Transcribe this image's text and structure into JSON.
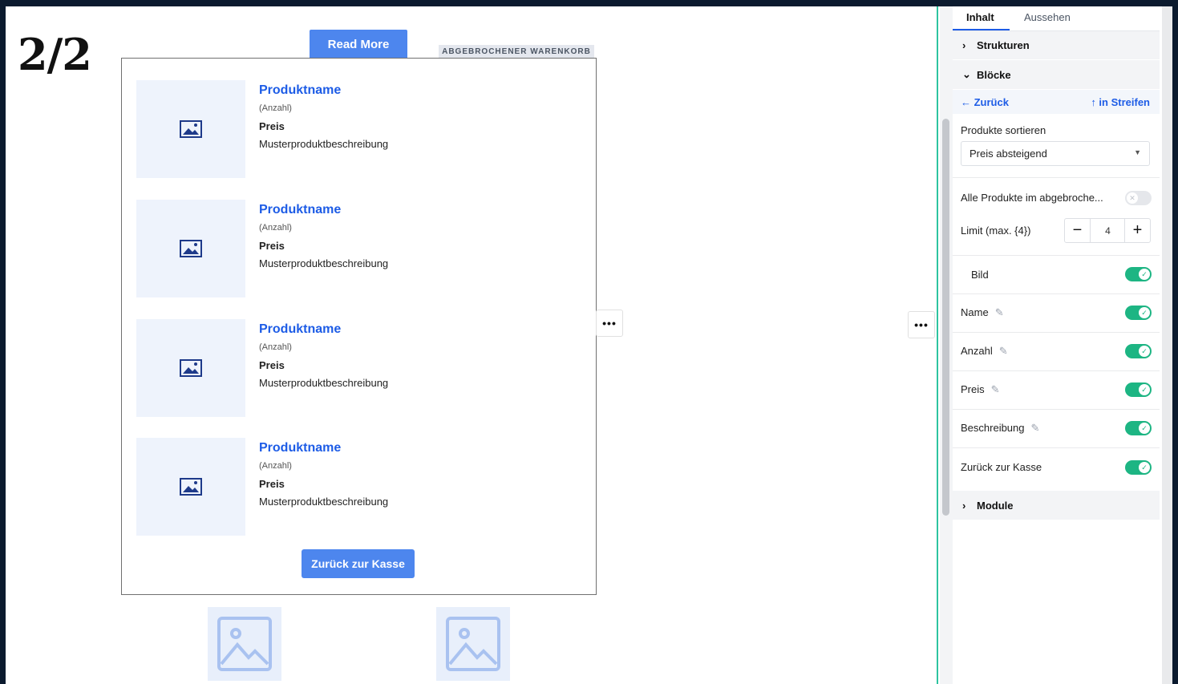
{
  "step": "2/2",
  "canvas": {
    "read_more_label": "Read More",
    "section_tag": "ABGEBROCHENER WARENKORB",
    "products": [
      {
        "name": "Produktname",
        "qty": "(Anzahl)",
        "price": "Preis",
        "desc": "Musterproduktbeschreibung"
      },
      {
        "name": "Produktname",
        "qty": "(Anzahl)",
        "price": "Preis",
        "desc": "Musterproduktbeschreibung"
      },
      {
        "name": "Produktname",
        "qty": "(Anzahl)",
        "price": "Preis",
        "desc": "Musterproduktbeschreibung"
      },
      {
        "name": "Produktname",
        "qty": "(Anzahl)",
        "price": "Preis",
        "desc": "Musterproduktbeschreibung"
      }
    ],
    "checkout_label": "Zurück zur Kasse",
    "more_icon": "•••"
  },
  "panel": {
    "tabs": [
      {
        "label": "Inhalt",
        "active": true
      },
      {
        "label": "Aussehen",
        "active": false
      }
    ],
    "sections": {
      "structures": "Strukturen",
      "blocks": "Blöcke",
      "modules": "Module"
    },
    "nav": {
      "back": "← Zurück",
      "up": "↑ in Streifen"
    },
    "sort": {
      "label": "Produkte sortieren",
      "value": "Preis absteigend"
    },
    "all_products": {
      "label": "Alle Produkte im abgebroche...",
      "on": false
    },
    "limit": {
      "label": "Limit (max. {4})",
      "value": "4"
    },
    "toggles": [
      {
        "label": "Bild",
        "editable": false,
        "on": true
      },
      {
        "label": "Name",
        "editable": true,
        "on": true
      },
      {
        "label": "Anzahl",
        "editable": true,
        "on": true
      },
      {
        "label": "Preis",
        "editable": true,
        "on": true
      },
      {
        "label": "Beschreibung",
        "editable": true,
        "on": true
      },
      {
        "label": "Zurück zur Kasse",
        "editable": false,
        "on": true
      }
    ]
  },
  "colors": {
    "accent": "#4d86ee",
    "link": "#1d5ce6",
    "toggle_on": "#1db583",
    "divider": "#2ec4a0"
  }
}
